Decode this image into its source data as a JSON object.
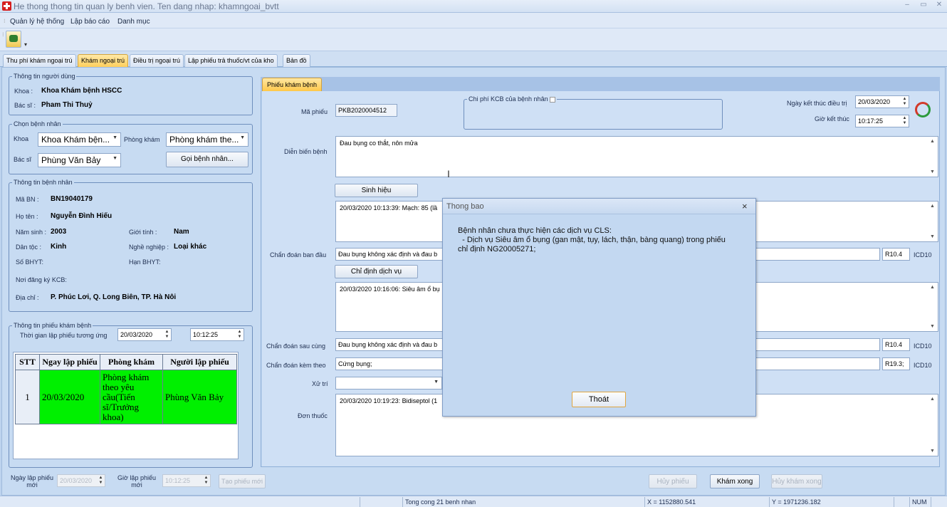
{
  "window": {
    "title": "He thong thong tin quan ly benh vien. Ten dang nhap: khamngoai_bvtt"
  },
  "menu": [
    "Quản lý hệ thống",
    "Lập báo cáo",
    "Danh mục"
  ],
  "tabs": [
    "Thu phí khám ngoại trú",
    "Khám ngoại trú",
    "Điều trị ngoại trú",
    "Lập phiếu trả thuốc/vt của kho",
    "Bản đồ"
  ],
  "user_info": {
    "legend": "Thông tin người dùng",
    "khoa_label": "Khoa :",
    "khoa": "Khoa Khám bệnh  HSCC",
    "bacsi_label": "Bác sĩ :",
    "bacsi": "Pham Thi Thuỷ"
  },
  "choose_patient": {
    "legend": "Chọn bệnh nhân",
    "khoa_label": "Khoa",
    "khoa_value": "Khoa Khám bện...",
    "phongkham_label": "Phòng khám",
    "phongkham_value": "Phòng khám the...",
    "bacsi_label": "Bác sĩ",
    "bacsi_value": "Phùng Văn Bảy",
    "call_button": "Gọi bệnh nhân..."
  },
  "patient_info": {
    "legend": "Thông tin bệnh nhân",
    "ma_bn_label": "Mã BN :",
    "ma_bn": "BN19040179",
    "ho_ten_label": "Họ tên :",
    "ho_ten": "Nguyễn Đình Hiếu",
    "nam_sinh_label": "Năm sinh :",
    "nam_sinh": "2003",
    "gioi_tinh_label": "Giới tính :",
    "gioi_tinh": "Nam",
    "dan_toc_label": "Dân tộc :",
    "dan_toc": "Kinh",
    "nghe_nghiep_label": "Nghề nghiệp :",
    "nghe_nghiep": "Loại khác",
    "so_bhyt_label": "Số BHYT:",
    "han_bhyt_label": "Hạn BHYT:",
    "noi_dk_label": "Nơi đăng ký KCB:",
    "dia_chi_label": "Địa chỉ :",
    "dia_chi": "P. Phúc Lơi, Q. Long Biên, TP. Hà Nôi"
  },
  "visit_info": {
    "legend": "Thông tin phiếu khám bệnh",
    "time_label": "Thời gian lập phiếu tương ứng",
    "date": "20/03/2020",
    "time": "10:12:25",
    "headers": [
      "STT",
      "Ngay lập phiếu",
      "Phòng khám",
      "Người lập phiếu"
    ],
    "rows": [
      {
        "stt": "1",
        "date": "20/03/2020",
        "room": "Phòng khám theo yêu cầu(Tiến sĩ/Trưởng khoa)",
        "creator": "Phùng Văn Bảy"
      }
    ]
  },
  "new_visit": {
    "date_label": "Ngày lập phiếu mới",
    "date": "20/03/2020",
    "time_label": "Giờ lập phiếu mới",
    "time": "10:12:25",
    "button": "Tạo phiếu mới"
  },
  "exam": {
    "tab": "Phiếu khám bệnh",
    "ma_phieu_label": "Mã phiếu",
    "ma_phieu": "PKB2020004512",
    "chiphi_label": "Chi phí KCB của bệnh nhân",
    "end_date_label": "Ngày kết thúc điều trị",
    "end_date": "20/03/2020",
    "end_time_label": "Giờ kết thúc",
    "end_time": "10:17:25",
    "dien_bien_label": "Diễn biến bệnh",
    "dien_bien": "Đau bụng co thắt, nôn mửa",
    "sinh_hieu_button": "Sinh hiệu",
    "sinh_hieu_text": "20/03/2020 10:13:39: Mạch: 85 (lầ",
    "cd_ban_dau_label": "Chẩn đoán ban đầu",
    "cd_ban_dau": "Đau bụng không xác định và đau b",
    "cd_ban_dau_code": "R10.4",
    "chi_dinh_button": "Chỉ định dịch vụ",
    "chi_dinh_text": "20/03/2020 10:16:06: Siêu âm ổ bụ",
    "cd_sau_cung_label": "Chẩn đoán sau cùng",
    "cd_sau_cung": "Đau bụng không xác định và đau b",
    "cd_sau_cung_code": "R10.4",
    "cd_kem_theo_label": "Chẩn đoán kèm theo",
    "cd_kem_theo": "Cứng bụng;",
    "cd_kem_theo_code": "R19.3;",
    "icd_label": "ICD10",
    "xu_tri_label": "Xử trí",
    "don_thuoc_label": "Đơn thuốc",
    "don_thuoc": "20/03/2020 10:19:23:  Bidiseptol (1",
    "btn_huy_phieu": "Hủy phiếu",
    "btn_kham_xong": "Khám xong",
    "btn_huy_kham_xong": "Hủy khám xong"
  },
  "dialog": {
    "title": "Thong bao",
    "message": "Bệnh nhân chưa thực hiện các dịch vụ CLS:\n  - Dịch vụ Siêu âm ổ bụng (gan mật, tụy, lách, thận, bàng quang) trong phiếu\nchỉ định NG20005271;",
    "ok": "Thoát"
  },
  "status": {
    "summary": "Tong cong 21 benh nhan",
    "x": "X = 1152880.541",
    "y": "Y = 1971236.182",
    "num": "NUM"
  }
}
